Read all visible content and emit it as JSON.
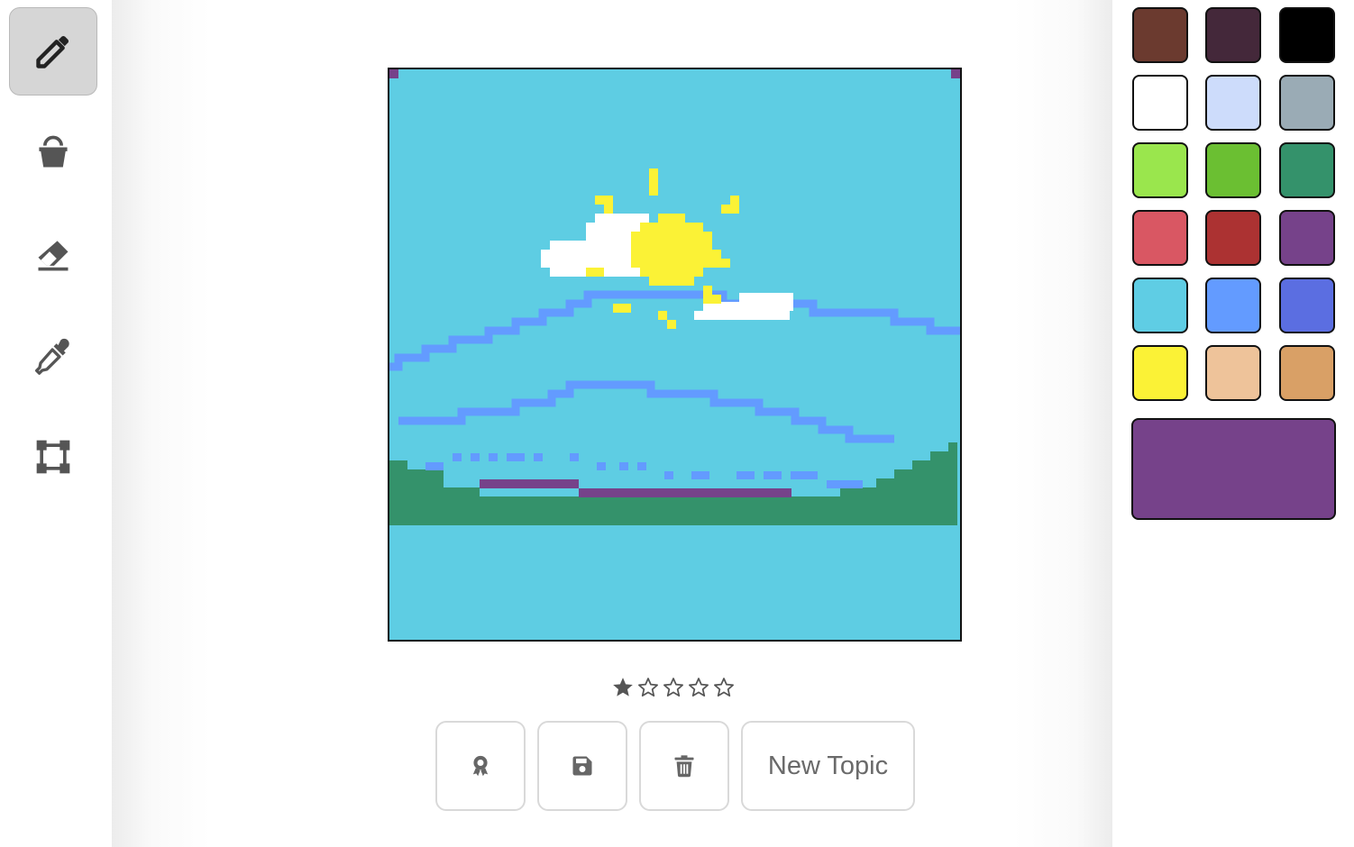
{
  "tools": [
    {
      "name": "pencil",
      "icon": "pencil-icon",
      "active": true
    },
    {
      "name": "fill",
      "icon": "bucket-icon",
      "active": false
    },
    {
      "name": "eraser",
      "icon": "eraser-icon",
      "active": false
    },
    {
      "name": "eyedropper",
      "icon": "eyedropper-icon",
      "active": false
    },
    {
      "name": "select",
      "icon": "selection-icon",
      "active": false
    }
  ],
  "rating": {
    "value": 1,
    "max": 5
  },
  "actions": {
    "award_icon": "award-icon",
    "save_icon": "save-icon",
    "delete_icon": "trash-icon",
    "new_topic_label": "New Topic"
  },
  "palette": {
    "colors": [
      "#6b3a2f",
      "#44283a",
      "#000000",
      "#ffffff",
      "#cddcfb",
      "#9aabb5",
      "#9ae64d",
      "#6bbf32",
      "#34926b",
      "#d95763",
      "#ac3232",
      "#76428a",
      "#5fcde4",
      "#639bff",
      "#5b6ee1",
      "#fbf236",
      "#eec39a",
      "#d9a066"
    ],
    "selected_color": "#76428a"
  },
  "artwork_colors": {
    "sky": "#5ecde3",
    "sun": "#fbf236",
    "cloud": "#ffffff",
    "wave": "#639bff",
    "hills": "#34926b",
    "accent": "#76428a"
  }
}
